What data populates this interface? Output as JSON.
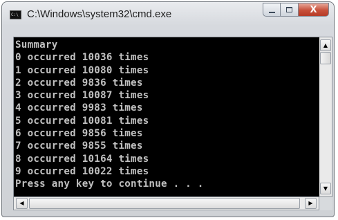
{
  "window": {
    "title": "C:\\Windows\\system32\\cmd.exe",
    "icon_text": "C:\\"
  },
  "caption_buttons": {
    "minimize_icon": "minimize-icon",
    "maximize_icon": "maximize-icon",
    "close_glyph": "X"
  },
  "console": {
    "background": "#000000",
    "foreground": "#c0c0c0",
    "lines": [
      "Summary",
      "0 occurred 10036 times",
      "1 occurred 10080 times",
      "2 occurred 9836 times",
      "3 occurred 10087 times",
      "4 occurred 9983 times",
      "5 occurred 10081 times",
      "6 occurred 9856 times",
      "7 occurred 9855 times",
      "8 occurred 10164 times",
      "9 occurred 10022 times",
      "Press any key to continue . . ."
    ]
  },
  "scrollbars": {
    "up_glyph": "▲",
    "down_glyph": "▼",
    "left_glyph": "◀",
    "right_glyph": "▶"
  }
}
